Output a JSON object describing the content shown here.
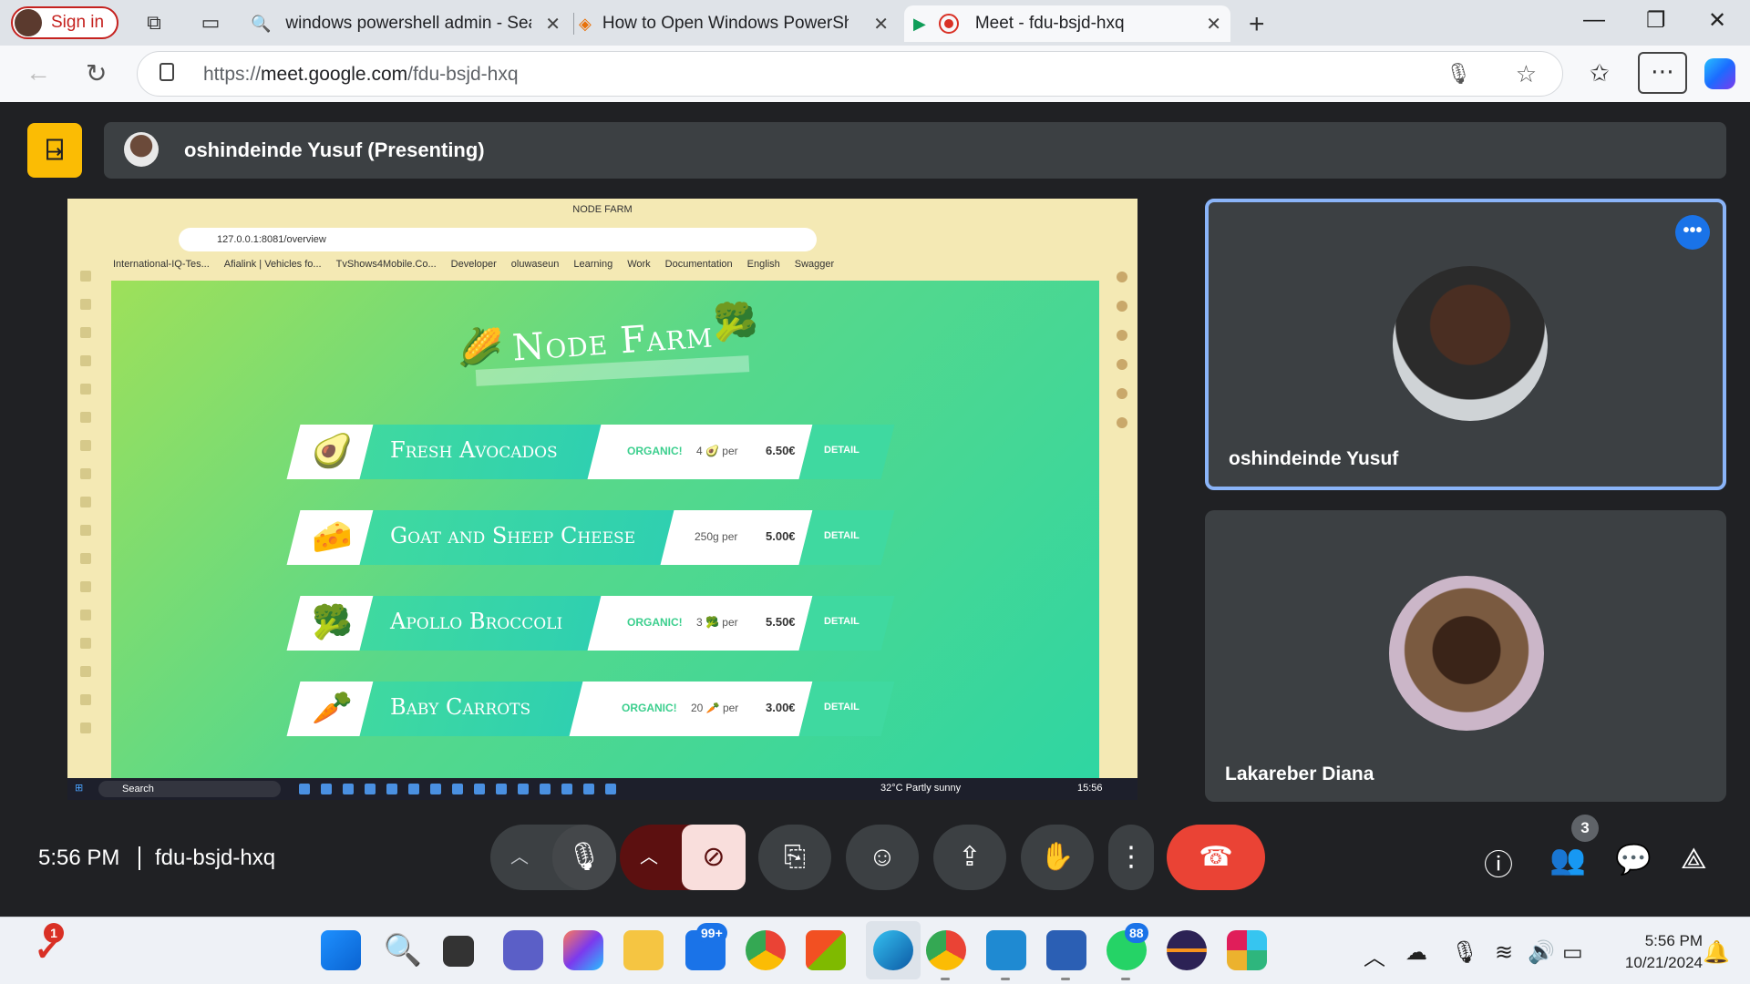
{
  "browser": {
    "signin_label": "Sign in",
    "tabs": [
      {
        "title": "windows powershell admin - Sear",
        "active": false
      },
      {
        "title": "How to Open Windows PowerShe",
        "active": false
      },
      {
        "title": "Meet - fdu-bsjd-hxq",
        "active": true
      }
    ],
    "url_prefix": "https://",
    "url_host": "meet.google.com",
    "url_path": "/fdu-bsjd-hxq"
  },
  "meet": {
    "presenter_label": "oshindeinde Yusuf (Presenting)",
    "time": "5:56 PM",
    "meeting_code": "fdu-bsjd-hxq",
    "participants": [
      {
        "name": "oshindeinde Yusuf",
        "speaking": true
      },
      {
        "name": "Lakareber Diana",
        "speaking": false
      }
    ],
    "participant_count": "3",
    "colors": {
      "accent": "#8ab4f8",
      "end_call": "#ea4335",
      "logo": "#fbbc04"
    }
  },
  "shared_screen": {
    "window_title": "NODE FARM",
    "url": "127.0.0.1:8081/overview",
    "bookmarks": [
      "International-IQ-Tes...",
      "Afialink | Vehicles fo...",
      "TvShows4Mobile.Co...",
      "Developer",
      "oluwaseun",
      "Learning",
      "Work",
      "Documentation",
      "English",
      "Swagger"
    ],
    "page_title": "Node Farm",
    "products": [
      {
        "emoji": "🥑",
        "name": "Fresh Avocados",
        "organic": "ORGANIC!",
        "qty": "4 🥑 per",
        "price": "6.50€",
        "detail": "DETAIL"
      },
      {
        "emoji": "🧀",
        "name": "Goat and Sheep Cheese",
        "organic": "",
        "qty": "250g per",
        "price": "5.00€",
        "detail": "DETAIL"
      },
      {
        "emoji": "🥦",
        "name": "Apollo Broccoli",
        "organic": "ORGANIC!",
        "qty": "3 🥦 per",
        "price": "5.50€",
        "detail": "DETAIL"
      },
      {
        "emoji": "🥕",
        "name": "Baby Carrots",
        "organic": "ORGANIC!",
        "qty": "20 🥕 per",
        "price": "3.00€",
        "detail": "DETAIL"
      }
    ],
    "taskbar_search": "Search",
    "weather": "32°C  Partly sunny",
    "clock": "15:56"
  },
  "taskbar": {
    "mail_badge": "99+",
    "whatsapp_badge": "88",
    "notification_badge": "1",
    "time": "5:56 PM",
    "date": "10/21/2024"
  }
}
